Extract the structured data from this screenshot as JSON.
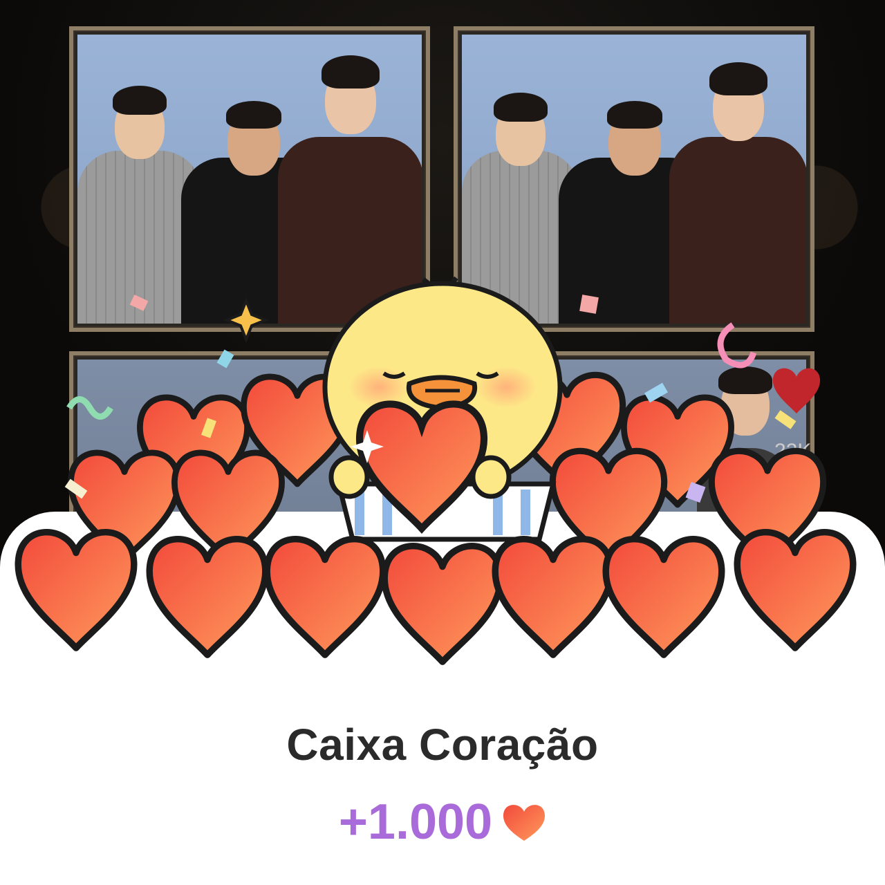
{
  "background": {
    "like_count": "22K"
  },
  "reward": {
    "title": "Caixa Coração",
    "amount": "+1.000",
    "amount_color": "#a96bd9",
    "heart_icon": "heart-icon"
  },
  "colors": {
    "heart_light": "#ff8a55",
    "heart_dark": "#f2463a",
    "chick_yellow": "#fde888",
    "card_bg": "#ffffff"
  }
}
